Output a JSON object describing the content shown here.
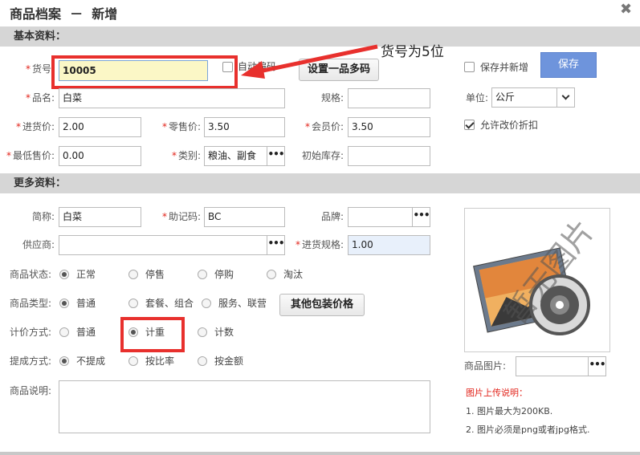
{
  "dialog": {
    "title": "商品档案  －  新增",
    "close": "✖"
  },
  "sections": {
    "basic": "基本资料：",
    "more": "更多资料："
  },
  "annotation": {
    "text": "货号为5位"
  },
  "basic": {
    "sku_label": "货号:",
    "sku_value": "10005",
    "auto_code_label": "自动编码",
    "multi_code_button": "设置一品多码",
    "save_new_label": "保存并新增",
    "save_button": "保存",
    "name_label": "品名:",
    "name_value": "白菜",
    "spec_label": "规格:",
    "spec_value": "",
    "unit_label": "单位:",
    "unit_value": "公斤",
    "purchase_price_label": "进货价:",
    "purchase_price_value": "2.00",
    "retail_price_label": "零售价:",
    "retail_price_value": "3.50",
    "member_price_label": "会员价:",
    "member_price_value": "3.50",
    "allow_discount_label": "允许改价折扣",
    "min_price_label": "最低售价:",
    "min_price_value": "0.00",
    "category_label": "类别:",
    "category_value": "粮油、副食",
    "initial_stock_label": "初始库存:",
    "initial_stock_value": "",
    "dots": "•••"
  },
  "more": {
    "short_name_label": "简称:",
    "short_name_value": "白菜",
    "mnemonic_label": "助记码:",
    "mnemonic_value": "BC",
    "brand_label": "品牌:",
    "brand_value": "",
    "supplier_label": "供应商:",
    "supplier_value": "",
    "purchase_spec_label": "进货规格:",
    "purchase_spec_value": "1.00",
    "status_label": "商品状态:",
    "status_options": [
      "正常",
      "停售",
      "停购",
      "淘汰"
    ],
    "type_label": "商品类型:",
    "type_options": [
      "普通",
      "套餐、组合",
      "服务、联营"
    ],
    "other_pack_button": "其他包装价格",
    "pricing_label": "计价方式:",
    "pricing_options": [
      "普通",
      "计重",
      "计数"
    ],
    "commission_label": "提成方式:",
    "commission_options": [
      "不提成",
      "按比率",
      "按金额"
    ],
    "description_label": "商品说明:",
    "image_label": "商品图片:",
    "image_placeholder_text": "暂无图片",
    "upload_title": "图片上传说明：",
    "upload_notes": [
      "1. 图片最大为200KB.",
      "2. 图片必须是png或者jpg格式."
    ]
  },
  "colors": {
    "required": "#e2231a",
    "highlight_box": "#e8302d",
    "save_button": "#6e94dc",
    "section_bar": "#d6d6d6"
  }
}
